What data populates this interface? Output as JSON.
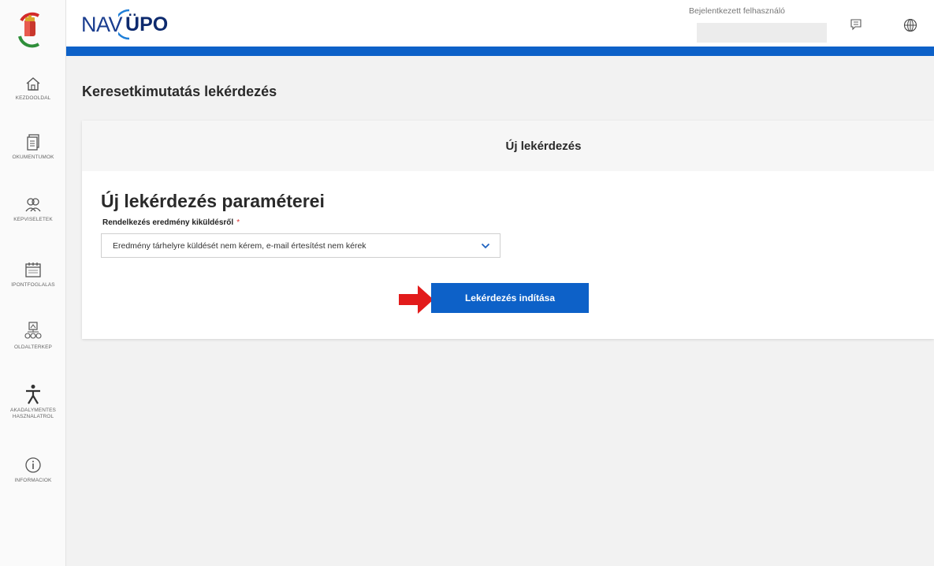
{
  "header": {
    "brand_nav": "NAV",
    "brand_upo": "ÜPO",
    "user_label": "Bejelentkezett felhasználó",
    "icons": [
      "message-icon",
      "globe-icon"
    ]
  },
  "sidebar": {
    "items": [
      {
        "label": "KEZDŐOLDAL",
        "icon": "home-icon"
      },
      {
        "label": "OKUMENTUMOK",
        "icon": "documents-icon"
      },
      {
        "label": "KÉPVISELETEK",
        "icon": "representatives-icon"
      },
      {
        "label": "ÍPONTFOGLALÁS",
        "icon": "calendar-icon"
      },
      {
        "label": "OLDALTÉRKÉP",
        "icon": "sitemap-icon"
      },
      {
        "label_line1": "AKADÁLYMENTES",
        "label_line2": "HASZNÁLATRÓL",
        "icon": "accessibility-icon"
      },
      {
        "label": "INFORMÁCIÓK",
        "icon": "info-icon"
      }
    ]
  },
  "main": {
    "page_title": "Keresetkimutatás lekérdezés",
    "card_title": "Új lekérdezés",
    "section_title": "Új lekérdezés paraméterei",
    "field_label": "Rendelkezés eredmény kiküldésről",
    "required_mark": "*",
    "select_value": "Eredmény tárhelyre küldését nem kérem, e-mail értesítést nem kérek",
    "submit_label": "Lekérdezés indítása"
  },
  "colors": {
    "accent": "#0d61c8",
    "arrow": "#e21b1b",
    "required": "#dd3333"
  }
}
